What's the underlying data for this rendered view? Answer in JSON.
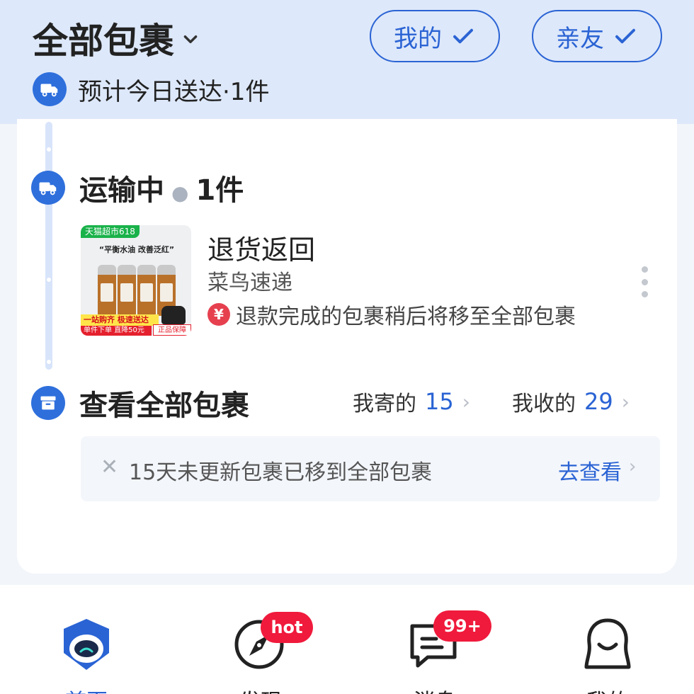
{
  "header": {
    "title": "全部包裹",
    "filters": [
      {
        "label": "我的",
        "checked": true
      },
      {
        "label": "亲友",
        "checked": true
      }
    ],
    "eta_text": "预计今日送达·1件"
  },
  "transit": {
    "title": "运输中",
    "count": "1件",
    "package": {
      "status": "退货返回",
      "carrier": "菜鸟速递",
      "note_icon": "¥",
      "note": "退款完成的包裹稍后将移至全部包裹",
      "thumbnail": {
        "tag": "天猫超市618",
        "headline": "“平衡水油 改善泛红”",
        "promo_line1": "一站购齐 极速送达",
        "promo_line2": "单件下单 直降50元",
        "promo_badge": "正品保障"
      }
    }
  },
  "all_packages": {
    "title": "查看全部包裹",
    "sent_label": "我寄的",
    "sent_count": "15",
    "received_label": "我收的",
    "received_count": "29"
  },
  "notice": {
    "text": "15天未更新包裹已移到全部包裹",
    "action": "去查看"
  },
  "tabbar": {
    "tabs": [
      {
        "label": "首页",
        "active": true
      },
      {
        "label": "发现",
        "badge": "hot"
      },
      {
        "label": "消息",
        "badge": "99+"
      },
      {
        "label": "我的"
      }
    ]
  },
  "colors": {
    "accent": "#2a63d4",
    "header_bg": "#dde8fa",
    "badge_red": "#f01a3c"
  }
}
